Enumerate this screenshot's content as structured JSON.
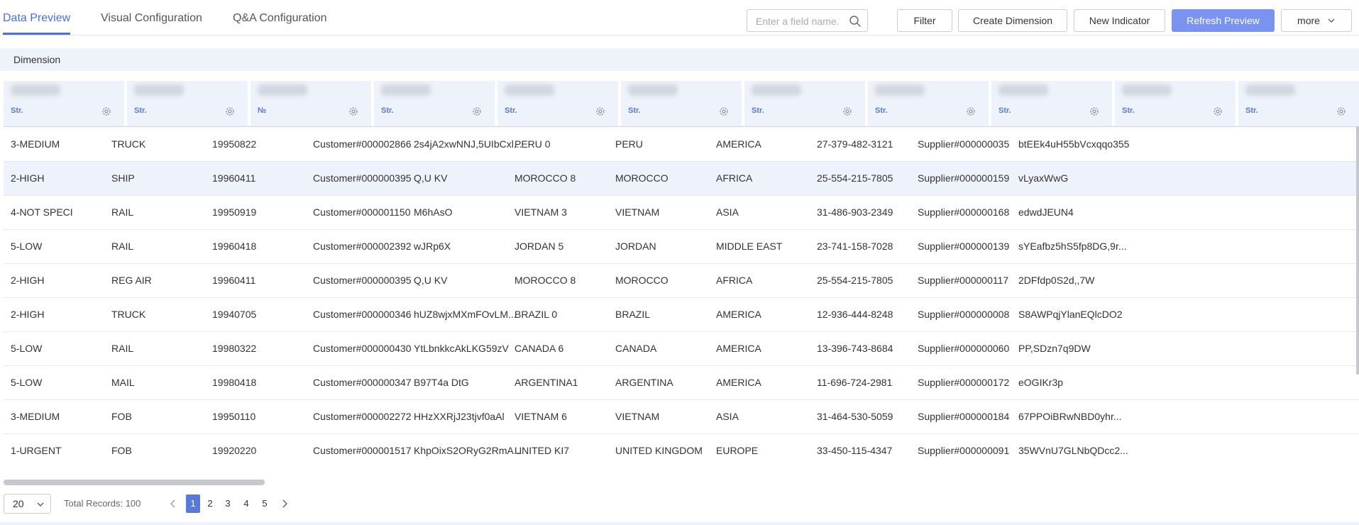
{
  "tabs": [
    "Data Preview",
    "Visual Configuration",
    "Q&A Configuration"
  ],
  "toolbar": {
    "search_placeholder": "Enter a field name.",
    "filter": "Filter",
    "create_dimension": "Create Dimension",
    "new_indicator": "New Indicator",
    "refresh_preview": "Refresh Preview",
    "more": "more"
  },
  "dimension_label": "Dimension",
  "column_types": [
    "Str.",
    "Str.",
    "№",
    "Str.",
    "Str.",
    "Str.",
    "Str.",
    "Str.",
    "Str.",
    "Str.",
    "Str."
  ],
  "rows": [
    [
      "3-MEDIUM",
      "TRUCK",
      "19950822",
      "Customer#000002866",
      "2s4jA2xwNNJ,5UIbCxl...",
      "PERU 0",
      "PERU",
      "AMERICA",
      "27-379-482-3121",
      "Supplier#000000035",
      "btEEk4uH55bVcxqqo355"
    ],
    [
      "2-HIGH",
      "SHIP",
      "19960411",
      "Customer#000000395",
      "Q,U KV",
      "MOROCCO 8",
      "MOROCCO",
      "AFRICA",
      "25-554-215-7805",
      "Supplier#000000159",
      "vLyaxWwG"
    ],
    [
      "4-NOT SPECI",
      "RAIL",
      "19950919",
      "Customer#000001150",
      "M6hAsO",
      "VIETNAM 3",
      "VIETNAM",
      "ASIA",
      "31-486-903-2349",
      "Supplier#000000168",
      "edwdJEUN4"
    ],
    [
      "5-LOW",
      "RAIL",
      "19960418",
      "Customer#000002392",
      "wJRp6X",
      "JORDAN 5",
      "JORDAN",
      "MIDDLE EAST",
      "23-741-158-7028",
      "Supplier#000000139",
      "sYEafbz5hS5fp8DG,9r..."
    ],
    [
      "2-HIGH",
      "REG AIR",
      "19960411",
      "Customer#000000395",
      "Q,U KV",
      "MOROCCO 8",
      "MOROCCO",
      "AFRICA",
      "25-554-215-7805",
      "Supplier#000000117",
      "2DFfdp0S2d,,7W"
    ],
    [
      "2-HIGH",
      "TRUCK",
      "19940705",
      "Customer#000000346",
      "hUZ8wjxMXmFOvLM...",
      "BRAZIL 0",
      "BRAZIL",
      "AMERICA",
      "12-936-444-8248",
      "Supplier#000000008",
      "S8AWPqjYlanEQlcDO2"
    ],
    [
      "5-LOW",
      "RAIL",
      "19980322",
      "Customer#000000430",
      "YtLbnkkcAkLKG59zV",
      "CANADA 6",
      "CANADA",
      "AMERICA",
      "13-396-743-8684",
      "Supplier#000000060",
      "PP,SDzn7q9DW"
    ],
    [
      "5-LOW",
      "MAIL",
      "19980418",
      "Customer#000000347",
      "B97T4a DtG",
      "ARGENTINA1",
      "ARGENTINA",
      "AMERICA",
      "11-696-724-2981",
      "Supplier#000000172",
      "eOGIKr3p"
    ],
    [
      "3-MEDIUM",
      "FOB",
      "19950110",
      "Customer#000002272",
      "HHzXXRjJ23tjvf0aAl",
      "VIETNAM 6",
      "VIETNAM",
      "ASIA",
      "31-464-530-5059",
      "Supplier#000000184",
      "67PPOiBRwNBD0yhr..."
    ],
    [
      "1-URGENT",
      "FOB",
      "19920220",
      "Customer#000001517",
      "KhpOixS2ORyG2RmA...",
      "UNITED KI7",
      "UNITED KINGDOM",
      "EUROPE",
      "33-450-115-4347",
      "Supplier#000000091",
      "35WVnU7GLNbQDcc2..."
    ]
  ],
  "pagination": {
    "page_size": "20",
    "total": "Total Records: 100",
    "pages": [
      "1",
      "2",
      "3",
      "4",
      "5"
    ],
    "current": "1"
  },
  "colors": {
    "accent": "#5a78d8",
    "primary_button": "#7b93f0",
    "header_bg": "#eef2fa",
    "highlight_row": "#eef2fb"
  },
  "icons": {
    "search": "search-icon",
    "column_settings": "gear-icon",
    "dropdown": "chevron-down-icon",
    "prev": "chevron-left-icon",
    "next": "chevron-right-icon"
  }
}
